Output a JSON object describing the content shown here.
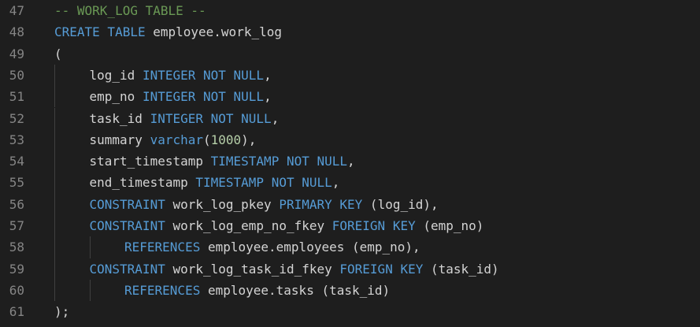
{
  "editor": {
    "language": "sql",
    "colors": {
      "background": "#1e1e1e",
      "line_number": "#858585",
      "plain": "#d4d4d4",
      "keyword": "#569cd6",
      "comment": "#6a9955",
      "number": "#b5cea8",
      "indent_guide": "#404040"
    },
    "lines": [
      {
        "number": "47",
        "indent": 0,
        "tokens": [
          {
            "t": "comment",
            "v": "-- WORK_LOG TABLE --"
          }
        ]
      },
      {
        "number": "48",
        "indent": 0,
        "tokens": [
          {
            "t": "keyword",
            "v": "CREATE TABLE"
          },
          {
            "t": "plain",
            "v": " employee.work_log"
          }
        ]
      },
      {
        "number": "49",
        "indent": 0,
        "tokens": [
          {
            "t": "plain",
            "v": "("
          }
        ]
      },
      {
        "number": "50",
        "indent": 1,
        "tokens": [
          {
            "t": "plain",
            "v": "log_id "
          },
          {
            "t": "keyword",
            "v": "INTEGER NOT NULL"
          },
          {
            "t": "plain",
            "v": ","
          }
        ]
      },
      {
        "number": "51",
        "indent": 1,
        "tokens": [
          {
            "t": "plain",
            "v": "emp_no "
          },
          {
            "t": "keyword",
            "v": "INTEGER NOT NULL"
          },
          {
            "t": "plain",
            "v": ","
          }
        ]
      },
      {
        "number": "52",
        "indent": 1,
        "tokens": [
          {
            "t": "plain",
            "v": "task_id "
          },
          {
            "t": "keyword",
            "v": "INTEGER NOT NULL"
          },
          {
            "t": "plain",
            "v": ","
          }
        ]
      },
      {
        "number": "53",
        "indent": 1,
        "tokens": [
          {
            "t": "plain",
            "v": "summary "
          },
          {
            "t": "keyword",
            "v": "varchar"
          },
          {
            "t": "plain",
            "v": "("
          },
          {
            "t": "number",
            "v": "1000"
          },
          {
            "t": "plain",
            "v": "),"
          }
        ]
      },
      {
        "number": "54",
        "indent": 1,
        "tokens": [
          {
            "t": "plain",
            "v": "start_timestamp "
          },
          {
            "t": "keyword",
            "v": "TIMESTAMP NOT NULL"
          },
          {
            "t": "plain",
            "v": ","
          }
        ]
      },
      {
        "number": "55",
        "indent": 1,
        "tokens": [
          {
            "t": "plain",
            "v": "end_timestamp "
          },
          {
            "t": "keyword",
            "v": "TIMESTAMP NOT NULL"
          },
          {
            "t": "plain",
            "v": ","
          }
        ]
      },
      {
        "number": "56",
        "indent": 1,
        "tokens": [
          {
            "t": "keyword",
            "v": "CONSTRAINT"
          },
          {
            "t": "plain",
            "v": " work_log_pkey "
          },
          {
            "t": "keyword",
            "v": "PRIMARY KEY"
          },
          {
            "t": "plain",
            "v": " (log_id),"
          }
        ]
      },
      {
        "number": "57",
        "indent": 1,
        "tokens": [
          {
            "t": "keyword",
            "v": "CONSTRAINT"
          },
          {
            "t": "plain",
            "v": " work_log_emp_no_fkey "
          },
          {
            "t": "keyword",
            "v": "FOREIGN KEY"
          },
          {
            "t": "plain",
            "v": " (emp_no)"
          }
        ]
      },
      {
        "number": "58",
        "indent": 2,
        "tokens": [
          {
            "t": "keyword",
            "v": "REFERENCES"
          },
          {
            "t": "plain",
            "v": " employee.employees (emp_no),"
          }
        ]
      },
      {
        "number": "59",
        "indent": 1,
        "tokens": [
          {
            "t": "keyword",
            "v": "CONSTRAINT"
          },
          {
            "t": "plain",
            "v": " work_log_task_id_fkey "
          },
          {
            "t": "keyword",
            "v": "FOREIGN KEY"
          },
          {
            "t": "plain",
            "v": " (task_id)"
          }
        ]
      },
      {
        "number": "60",
        "indent": 2,
        "tokens": [
          {
            "t": "keyword",
            "v": "REFERENCES"
          },
          {
            "t": "plain",
            "v": " employee.tasks (task_id)"
          }
        ]
      },
      {
        "number": "61",
        "indent": 0,
        "tokens": [
          {
            "t": "plain",
            "v": ");"
          }
        ]
      }
    ]
  }
}
